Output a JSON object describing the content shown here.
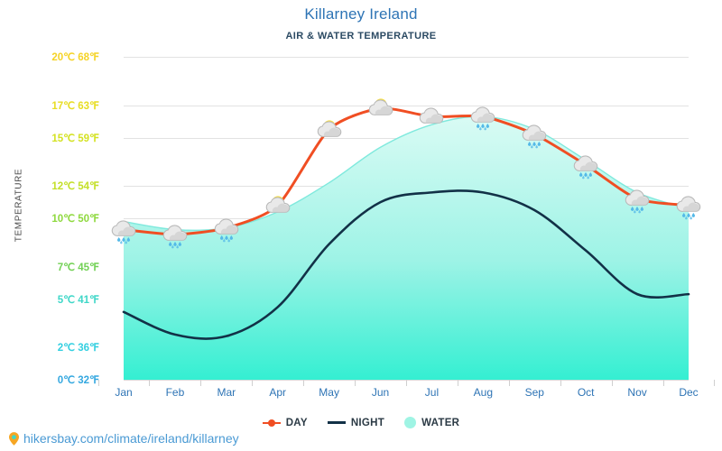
{
  "header": {
    "title": "Killarney Ireland",
    "subtitle": "AIR & WATER TEMPERATURE"
  },
  "footer": {
    "url": "hikersbay.com/climate/ireland/killarney",
    "pin_icon": "location-pin-icon"
  },
  "legend": {
    "position": "bottom-center",
    "items": [
      {
        "label": "DAY",
        "color": "#f04e23",
        "marker": "line-dot"
      },
      {
        "label": "NIGHT",
        "color": "#123147",
        "marker": "line"
      },
      {
        "label": "WATER",
        "color": "#9ff4e4",
        "marker": "circle"
      }
    ]
  },
  "axes": {
    "y_title": "TEMPERATURE",
    "y_ticks": [
      {
        "label": "20℃ 68℉",
        "value": 20,
        "color": "#f5d327"
      },
      {
        "label": "17℃ 63℉",
        "value": 17,
        "color": "#e8dd22"
      },
      {
        "label": "15℃ 59℉",
        "value": 15,
        "color": "#d4e223"
      },
      {
        "label": "12℃ 54℉",
        "value": 12,
        "color": "#c4e02a"
      },
      {
        "label": "10℃ 50℉",
        "value": 10,
        "color": "#8fd93f"
      },
      {
        "label": "7℃ 45℉",
        "value": 7,
        "color": "#72d155"
      },
      {
        "label": "5℃ 41℉",
        "value": 5,
        "color": "#3fd7c8"
      },
      {
        "label": "2℃ 36℉",
        "value": 2,
        "color": "#33cfe0"
      },
      {
        "label": "0℃ 32℉",
        "value": 0,
        "color": "#35a8e0"
      }
    ]
  },
  "chart_data": {
    "type": "line",
    "title": "Killarney Ireland",
    "subtitle": "AIR & WATER TEMPERATURE",
    "xlabel": "",
    "ylabel": "TEMPERATURE",
    "ylim": [
      0,
      20
    ],
    "grid": true,
    "legend_position": "bottom-center",
    "categories": [
      "Jan",
      "Feb",
      "Mar",
      "Apr",
      "May",
      "Jun",
      "Jul",
      "Aug",
      "Sep",
      "Oct",
      "Nov",
      "Dec"
    ],
    "y_tick_labels": [
      "0℃ 32℉",
      "2℃ 36℉",
      "5℃ 41℉",
      "7℃ 45℉",
      "10℃ 50℉",
      "12℃ 54℉",
      "15℃ 59℉",
      "17℃ 63℉",
      "20℃ 68℉"
    ],
    "y_tick_values": [
      0,
      2,
      5,
      7,
      10,
      12,
      15,
      17,
      20
    ],
    "series": [
      {
        "name": "DAY",
        "color": "#f04e23",
        "style": "line-with-markers",
        "values": [
          9.3,
          9.0,
          9.4,
          10.8,
          15.5,
          16.8,
          16.3,
          16.3,
          15.2,
          13.3,
          11.2,
          10.8
        ]
      },
      {
        "name": "NIGHT",
        "color": "#123147",
        "style": "line",
        "values": [
          4.2,
          2.8,
          2.7,
          4.5,
          8.4,
          11.0,
          11.6,
          11.6,
          10.5,
          8.0,
          5.3,
          5.3
        ]
      },
      {
        "name": "WATER",
        "color": "#9ff4e4",
        "style": "area",
        "values": [
          9.8,
          9.3,
          9.4,
          10.4,
          12.2,
          14.4,
          15.8,
          16.3,
          15.5,
          13.6,
          11.6,
          10.6
        ]
      }
    ],
    "weather_icons": [
      {
        "month": "Jan",
        "icon": "rain-cloud-icon"
      },
      {
        "month": "Feb",
        "icon": "rain-cloud-icon"
      },
      {
        "month": "Mar",
        "icon": "rain-cloud-icon"
      },
      {
        "month": "Apr",
        "icon": "sun-behind-cloud-icon"
      },
      {
        "month": "May",
        "icon": "sun-behind-cloud-icon"
      },
      {
        "month": "Jun",
        "icon": "sun-behind-cloud-icon"
      },
      {
        "month": "Jul",
        "icon": "cloud-icon"
      },
      {
        "month": "Aug",
        "icon": "rain-cloud-icon"
      },
      {
        "month": "Sep",
        "icon": "rain-cloud-icon"
      },
      {
        "month": "Oct",
        "icon": "rain-cloud-icon"
      },
      {
        "month": "Nov",
        "icon": "rain-cloud-icon"
      },
      {
        "month": "Dec",
        "icon": "rain-cloud-icon"
      }
    ]
  }
}
